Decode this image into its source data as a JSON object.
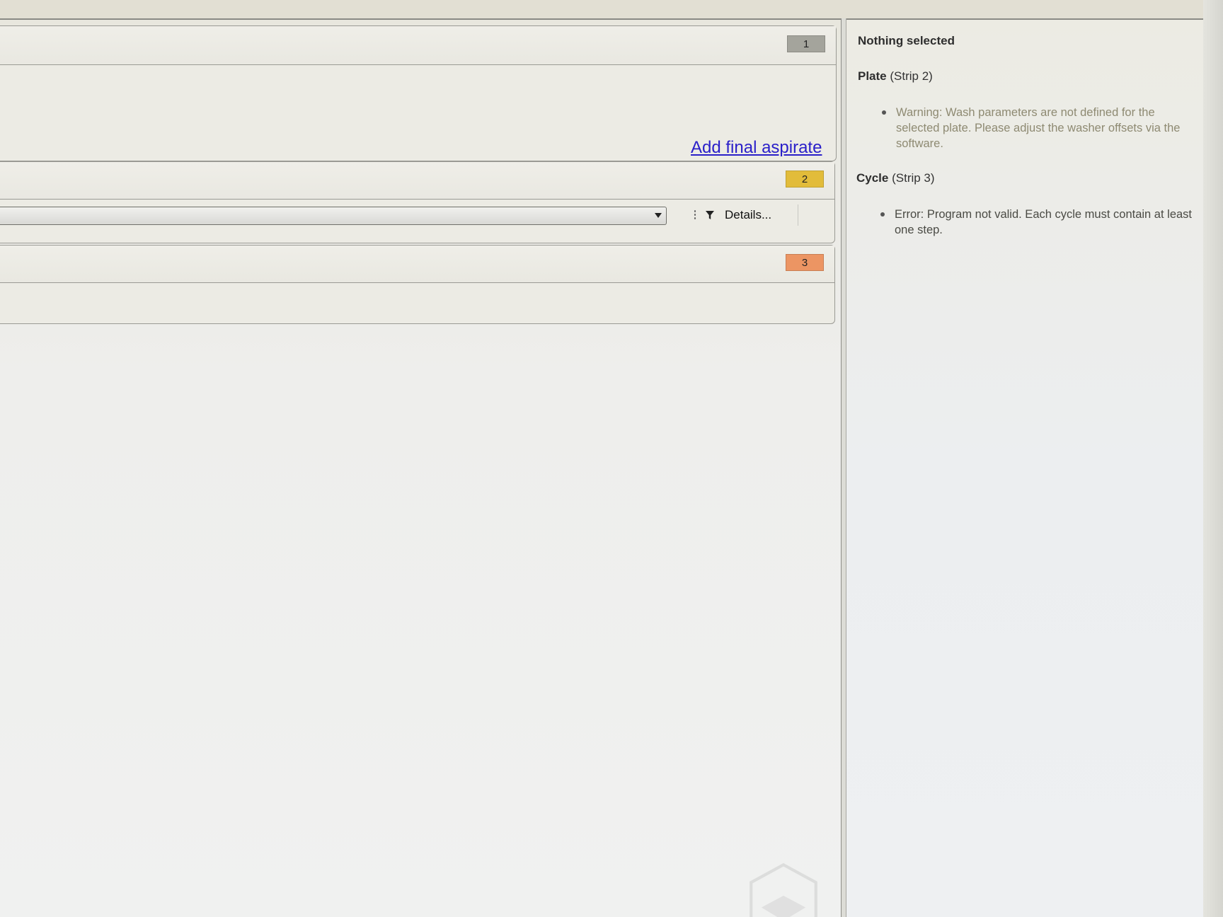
{
  "steps": [
    {
      "badge": "1",
      "badge_color": "#a4a49c",
      "link_label": "Add final aspirate"
    },
    {
      "badge": "2",
      "badge_color": "#e2bc3a",
      "details_label": "Details..."
    },
    {
      "badge": "3",
      "badge_color": "#ec9563"
    }
  ],
  "side_panel": {
    "heading": "Nothing selected",
    "plate": {
      "title_bold": "Plate",
      "title_rest": " (Strip 2)",
      "message": "Warning: Wash parameters are not defined for the selected plate. Please adjust the washer offsets via the software."
    },
    "cycle": {
      "title_bold": "Cycle",
      "title_rest": " (Strip 3)",
      "message": "Error: Program not valid. Each cycle must contain at least one step."
    }
  },
  "colors": {
    "link": "#2a1fc9",
    "warning_text": "#8e8a72",
    "error_text": "#4a4a44"
  },
  "icons": [
    "filter-icon",
    "grip-icon",
    "dropdown-arrow-icon",
    "bullet-icon",
    "logo-watermark-icon"
  ]
}
